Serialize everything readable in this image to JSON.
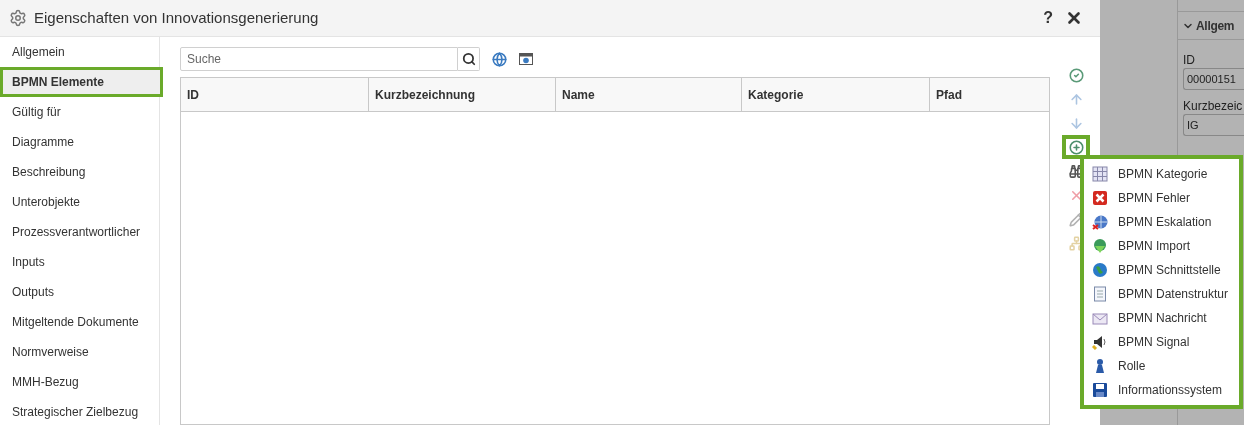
{
  "window": {
    "title": "Eigenschaften von Innovationsgenerierung",
    "help": "?"
  },
  "sidebar": {
    "items": [
      {
        "label": "Allgemein",
        "selected": false
      },
      {
        "label": "BPMN Elemente",
        "selected": true
      },
      {
        "label": "Gültig für",
        "selected": false
      },
      {
        "label": "Diagramme",
        "selected": false
      },
      {
        "label": "Beschreibung",
        "selected": false
      },
      {
        "label": "Unterobjekte",
        "selected": false
      },
      {
        "label": "Prozessverantwortlicher",
        "selected": false
      },
      {
        "label": "Inputs",
        "selected": false
      },
      {
        "label": "Outputs",
        "selected": false
      },
      {
        "label": "Mitgeltende Dokumente",
        "selected": false
      },
      {
        "label": "Normverweise",
        "selected": false
      },
      {
        "label": "MMH-Bezug",
        "selected": false
      },
      {
        "label": "Strategischer Zielbezug",
        "selected": false
      }
    ]
  },
  "search": {
    "placeholder": "Suche"
  },
  "table": {
    "columns": [
      "ID",
      "Kurzbezeichnung",
      "Name",
      "Kategorie",
      "Pfad"
    ]
  },
  "toolbar": [
    {
      "kind": "check",
      "disabled": false,
      "highlighted": false
    },
    {
      "kind": "up",
      "disabled": true,
      "highlighted": false
    },
    {
      "kind": "down",
      "disabled": true,
      "highlighted": false
    },
    {
      "kind": "add",
      "disabled": false,
      "highlighted": true
    },
    {
      "kind": "binoculars",
      "disabled": false,
      "highlighted": false
    },
    {
      "kind": "delete",
      "disabled": true,
      "highlighted": false
    },
    {
      "kind": "edit",
      "disabled": true,
      "highlighted": false
    },
    {
      "kind": "tree",
      "disabled": true,
      "highlighted": false
    }
  ],
  "add_menu": {
    "items": [
      {
        "kind": "grid",
        "label": "BPMN Kategorie"
      },
      {
        "kind": "error",
        "label": "BPMN Fehler"
      },
      {
        "kind": "escalation",
        "label": "BPMN Eskalation"
      },
      {
        "kind": "import",
        "label": "BPMN Import"
      },
      {
        "kind": "globe",
        "label": "BPMN Schnittstelle"
      },
      {
        "kind": "document",
        "label": "BPMN Datenstruktur"
      },
      {
        "kind": "mail",
        "label": "BPMN Nachricht"
      },
      {
        "kind": "signal",
        "label": "BPMN Signal"
      },
      {
        "kind": "person",
        "label": "Rolle"
      },
      {
        "kind": "disk",
        "label": "Informationssystem"
      }
    ]
  },
  "background_panel": {
    "section": "Allgem",
    "fields": [
      {
        "label": "ID",
        "value": "00000151"
      },
      {
        "label": "Kurzbezeic",
        "value": "IG"
      }
    ]
  }
}
